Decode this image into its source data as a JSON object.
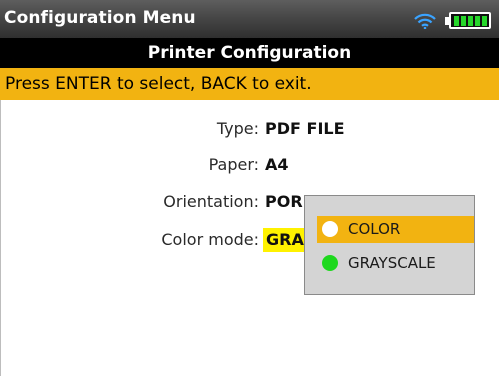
{
  "window": {
    "title": "Configuration Menu"
  },
  "status": {
    "wifi_icon": "wifi-icon",
    "battery_icon": "battery-icon",
    "battery_color": "#26d62a"
  },
  "header": {
    "title": "Printer Configuration"
  },
  "hint": {
    "text": "Press ENTER to select, BACK to exit."
  },
  "settings": [
    {
      "label": "Type:",
      "value": "PDF FILE"
    },
    {
      "label": "Paper:",
      "value": "A4"
    },
    {
      "label": "Orientation:",
      "value": "POR"
    },
    {
      "label": "Color mode:",
      "value": "GRA"
    }
  ],
  "dropdown": {
    "options": [
      {
        "label": "COLOR",
        "indicator": "white",
        "selected": true
      },
      {
        "label": "GRAYSCALE",
        "indicator": "green",
        "selected": false
      }
    ]
  },
  "colors": {
    "accent": "#f2b311",
    "highlight": "#fff200",
    "header_bg": "#000000"
  }
}
